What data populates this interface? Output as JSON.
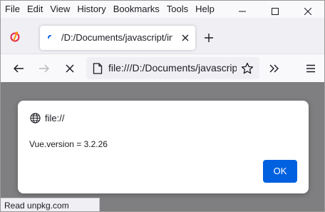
{
  "menubar": {
    "items": [
      {
        "label": "File"
      },
      {
        "label": "Edit"
      },
      {
        "label": "View"
      },
      {
        "label": "History"
      },
      {
        "label": "Bookmarks"
      },
      {
        "label": "Tools"
      },
      {
        "label": "Help"
      }
    ]
  },
  "tab": {
    "title": "/D:/Documents/javascript/ind"
  },
  "toolbar": {
    "url": "file:///D:/Documents/javascript/"
  },
  "dialog": {
    "origin": "file://",
    "message": "Vue.version = 3.2.26",
    "ok_label": "OK"
  },
  "status": {
    "text": "Read unpkg.com"
  },
  "colors": {
    "accent": "#0061e0",
    "overlay": "#7f7f82",
    "chrome": "#f0f0f4"
  }
}
